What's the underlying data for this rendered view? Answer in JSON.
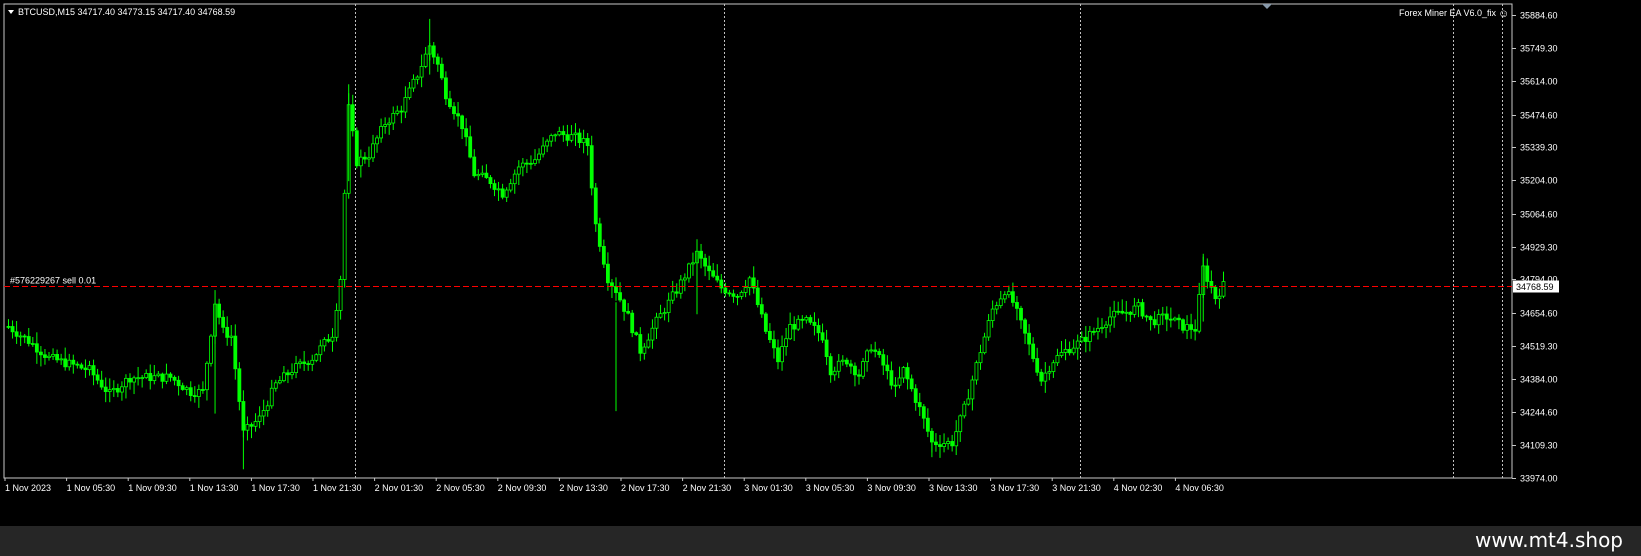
{
  "header": {
    "symbol_line": "BTCUSD,M15  34717.40 34773.15 34717.40 34768.59",
    "ea_label": "Forex Miner EA  V6.0_fix",
    "smiley": "☺"
  },
  "order_line": {
    "label": "#576229267 sell 0.01",
    "price": 34768.59
  },
  "current_price": "34768.59",
  "watermark": "www.mt4.shop",
  "colors": {
    "background": "#000000",
    "candles": "#00ff00",
    "order_line": "#ff0000",
    "grid_separator": "#c0c0c0",
    "axis_text": "#ffffff"
  },
  "chart_data": {
    "type": "candlestick",
    "timeframe": "M15",
    "y_ticks": [
      35884.6,
      35749.3,
      35614.0,
      35474.6,
      35339.3,
      35204.0,
      35064.6,
      34929.3,
      34794.0,
      34654.6,
      34519.3,
      34384.0,
      34244.6,
      34109.3,
      33974.0
    ],
    "y_tick_labels": [
      "35884.60",
      "35749.30",
      "35614.00",
      "35474.60",
      "35339.30",
      "35204.00",
      "35064.60",
      "34929.30",
      "34794.00",
      "34654.60",
      "34519.30",
      "34384.00",
      "34244.60",
      "34109.30",
      "33974.00"
    ],
    "ylim": [
      33974.0,
      35915.0
    ],
    "x_labels": [
      "1 Nov 2023",
      "1 Nov 05:30",
      "1 Nov 09:30",
      "1 Nov 13:30",
      "1 Nov 17:30",
      "1 Nov 21:30",
      "2 Nov 01:30",
      "2 Nov 05:30",
      "2 Nov 09:30",
      "2 Nov 13:30",
      "2 Nov 17:30",
      "2 Nov 21:30",
      "3 Nov 01:30",
      "3 Nov 05:30",
      "3 Nov 09:30",
      "3 Nov 13:30",
      "3 Nov 17:30",
      "3 Nov 21:30",
      "4 Nov 02:30",
      "4 Nov 06:30"
    ],
    "day_separators_bar_index": [
      86,
      177,
      265,
      357
    ],
    "bars_total": 300,
    "close_path": [
      [
        0,
        34600
      ],
      [
        5,
        34540
      ],
      [
        10,
        34470
      ],
      [
        20,
        34420
      ],
      [
        25,
        34320
      ],
      [
        30,
        34390
      ],
      [
        40,
        34390
      ],
      [
        45,
        34330
      ],
      [
        48,
        34330
      ],
      [
        51,
        34700
      ],
      [
        53,
        34580
      ],
      [
        55,
        34560
      ],
      [
        58,
        34160
      ],
      [
        62,
        34220
      ],
      [
        66,
        34360
      ],
      [
        70,
        34420
      ],
      [
        75,
        34470
      ],
      [
        80,
        34570
      ],
      [
        82,
        34800
      ],
      [
        84,
        35500
      ],
      [
        86,
        35280
      ],
      [
        89,
        35310
      ],
      [
        93,
        35440
      ],
      [
        97,
        35500
      ],
      [
        101,
        35640
      ],
      [
        104,
        35760
      ],
      [
        106,
        35680
      ],
      [
        108,
        35560
      ],
      [
        112,
        35430
      ],
      [
        115,
        35230
      ],
      [
        119,
        35200
      ],
      [
        122,
        35150
      ],
      [
        126,
        35260
      ],
      [
        130,
        35290
      ],
      [
        135,
        35400
      ],
      [
        140,
        35380
      ],
      [
        143,
        35350
      ],
      [
        145,
        35020
      ],
      [
        148,
        34800
      ],
      [
        150,
        34750
      ],
      [
        153,
        34640
      ],
      [
        156,
        34500
      ],
      [
        160,
        34620
      ],
      [
        165,
        34750
      ],
      [
        170,
        34900
      ],
      [
        173,
        34820
      ],
      [
        176,
        34760
      ],
      [
        180,
        34730
      ],
      [
        183,
        34800
      ],
      [
        187,
        34580
      ],
      [
        190,
        34460
      ],
      [
        193,
        34600
      ],
      [
        197,
        34620
      ],
      [
        201,
        34560
      ],
      [
        203,
        34420
      ],
      [
        207,
        34460
      ],
      [
        210,
        34400
      ],
      [
        213,
        34520
      ],
      [
        216,
        34440
      ],
      [
        219,
        34340
      ],
      [
        221,
        34420
      ],
      [
        225,
        34260
      ],
      [
        228,
        34120
      ],
      [
        233,
        34120
      ],
      [
        236,
        34260
      ],
      [
        240,
        34500
      ],
      [
        243,
        34670
      ],
      [
        246,
        34750
      ],
      [
        248,
        34700
      ],
      [
        252,
        34520
      ],
      [
        255,
        34380
      ],
      [
        258,
        34460
      ],
      [
        261,
        34500
      ],
      [
        265,
        34540
      ],
      [
        268,
        34580
      ],
      [
        272,
        34640
      ],
      [
        276,
        34660
      ],
      [
        279,
        34680
      ],
      [
        282,
        34620
      ],
      [
        286,
        34640
      ],
      [
        290,
        34600
      ],
      [
        293,
        34590
      ],
      [
        295,
        34840
      ],
      [
        298,
        34720
      ],
      [
        300,
        34769
      ]
    ]
  }
}
